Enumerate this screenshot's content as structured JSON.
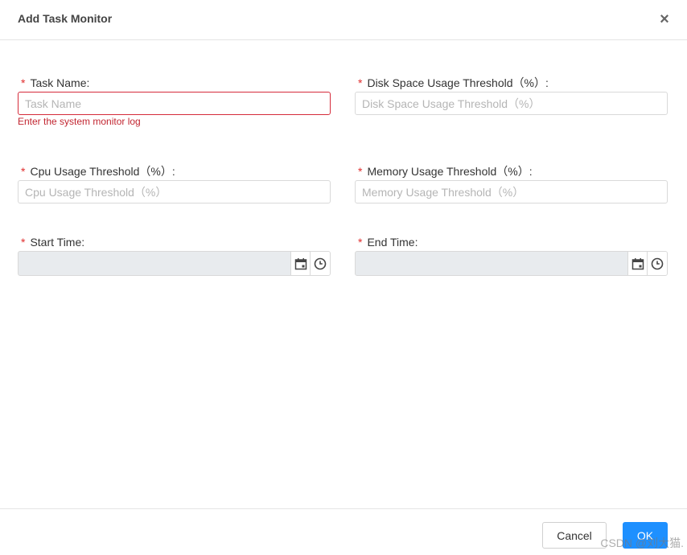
{
  "dialog": {
    "title": "Add Task Monitor",
    "close_glyph": "×"
  },
  "form": {
    "required_mark": "*",
    "task_name": {
      "label": "Task Name:",
      "placeholder": "Task Name",
      "value": "",
      "error": "Enter the system monitor log"
    },
    "disk": {
      "label": "Disk Space Usage Threshold（%）:",
      "placeholder": "Disk Space Usage Threshold（%）",
      "value": ""
    },
    "cpu": {
      "label": "Cpu Usage Threshold（%）:",
      "placeholder": "Cpu Usage Threshold（%）",
      "value": ""
    },
    "memory": {
      "label": "Memory Usage Threshold（%）:",
      "placeholder": "Memory Usage Threshold（%）",
      "value": ""
    },
    "start_time": {
      "label": "Start Time:",
      "value": ""
    },
    "end_time": {
      "label": "End Time:",
      "value": ""
    }
  },
  "icons": {
    "calendar": "calendar-icon",
    "clock": "clock-icon",
    "close": "close-icon"
  },
  "footer": {
    "cancel_label": "Cancel",
    "ok_label": "OK"
  },
  "watermark": "CSDN @刘大猫."
}
